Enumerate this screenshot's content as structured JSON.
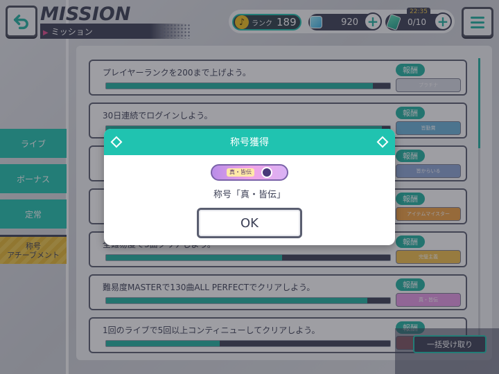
{
  "header": {
    "title": "MISSION",
    "subtitle": "ミッション",
    "rank_label": "ランク",
    "rank_value": "189",
    "gems": "920",
    "tickets": "0/10",
    "timer": "22:35"
  },
  "tabs": [
    {
      "label": "ライブ"
    },
    {
      "label": "ボーナス"
    },
    {
      "label": "定常"
    },
    {
      "label": "称号\nアチーブメント"
    }
  ],
  "missions": [
    {
      "text": "プレイヤーランクを200まで上げよう。",
      "progress": 0.94,
      "reward": "報酬",
      "plate": "プラチナ",
      "plate_color": "#d9dde6"
    },
    {
      "text": "30日連続でログインしよう。",
      "progress": 0.97,
      "reward": "報酬",
      "plate": "皆勤賞",
      "plate_color": "#6ab3d9"
    },
    {
      "text": "",
      "progress": 0.5,
      "reward": "報酬",
      "plate": "皆からいる",
      "plate_color": "#8ca6d6"
    },
    {
      "text": "",
      "progress": 0.5,
      "reward": "報酬",
      "plate": "アイテムマイスター",
      "plate_color": "#f0a040"
    },
    {
      "text": "全難易度で3曲クリアしよう。",
      "progress": 0.62,
      "reward": "報酬",
      "plate": "完璧主義",
      "plate_color": "#f3c04a"
    },
    {
      "text": "難易度MASTERで130曲ALL PERFECTでクリアしよう。",
      "progress": 0.92,
      "reward": "報酬",
      "plate": "真・皆伝",
      "plate_color": "#e79ae8"
    },
    {
      "text": "1回のライブで5回以上コンティニューしてクリアしよう。",
      "progress": 0.4,
      "reward": "報酬",
      "plate": "",
      "plate_color": "#cc6a6a"
    }
  ],
  "bulk_button": "一括受け取り",
  "modal": {
    "title": "称号獲得",
    "plate_text": "真・皆伝",
    "message": "称号「真・皆伝」",
    "ok": "OK"
  }
}
